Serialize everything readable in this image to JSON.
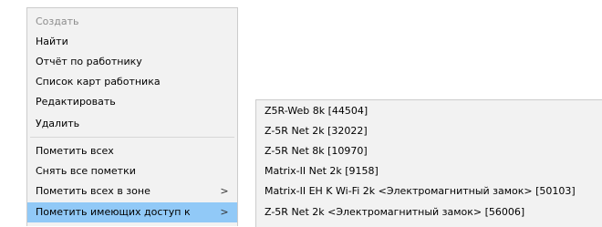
{
  "context_menu": {
    "items": [
      {
        "label": "Создать",
        "disabled": true
      },
      {
        "label": "Найти"
      },
      {
        "label": "Отчёт по работнику"
      },
      {
        "label": "Список карт работника"
      },
      {
        "label": "Редактировать"
      },
      {
        "label": "Удалить"
      },
      {
        "label": "Пометить всех"
      },
      {
        "label": "Снять все пометки"
      },
      {
        "label": "Пометить всех в зоне",
        "submenu_arrow": ">"
      },
      {
        "label": "Пометить имеющих доступ к",
        "submenu_arrow": ">",
        "highlighted": true
      }
    ]
  },
  "submenu": {
    "items": [
      {
        "label": "Z5R-Web 8k  [44504]"
      },
      {
        "label": "Z-5R Net 2k  [32022]"
      },
      {
        "label": "Z-5R Net 8k [10970]"
      },
      {
        "label": "Matrix-II Net 2k [9158]"
      },
      {
        "label": "Matrix-II EH K Wi-Fi 2k <Электромагнитный замок> [50103]"
      },
      {
        "label": "Z-5R Net 2k <Электромагнитный замок> [56006]"
      }
    ]
  },
  "colors": {
    "menu_background": "#f2f2f2",
    "highlight": "#91c9f7",
    "disabled_text": "#8d8d8d"
  }
}
